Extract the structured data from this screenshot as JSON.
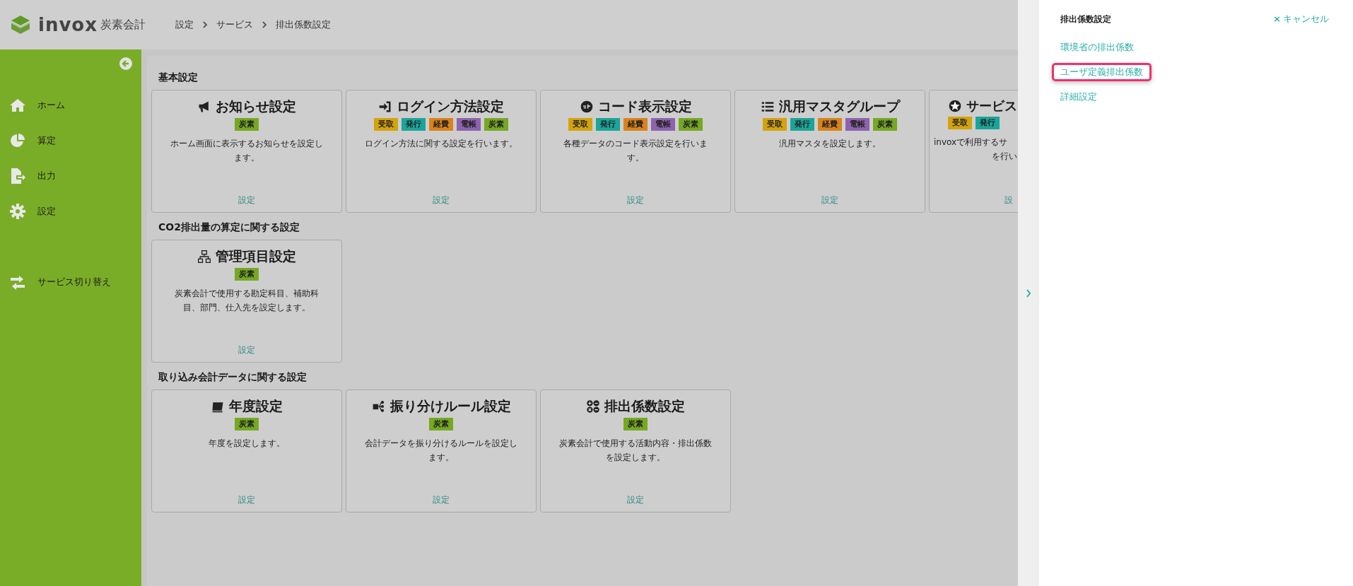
{
  "header": {
    "logo": {
      "name": "invox",
      "sub": "炭素会計"
    },
    "breadcrumb": [
      "設定",
      "サービス",
      "排出係数設定"
    ]
  },
  "sidebar": {
    "items": [
      {
        "label": "ホーム",
        "kind": "home"
      },
      {
        "label": "算定",
        "kind": "chart"
      },
      {
        "label": "出力",
        "kind": "export"
      },
      {
        "label": "設定",
        "kind": "gear"
      },
      {
        "label": "サービス切り替え",
        "kind": "switch"
      }
    ]
  },
  "sections": [
    {
      "title": "基本設定",
      "cards": [
        {
          "title": "お知らせ設定",
          "badges": [
            {
              "label": "炭素",
              "color": "#76a923"
            }
          ],
          "description_lines": [
            "ホーム画面に表示するお知らせを設定し",
            "ます。"
          ],
          "link": "設定"
        },
        {
          "title": "ログイン方法設定",
          "badges": [
            {
              "label": "受取",
              "color": "#d4a30a"
            },
            {
              "label": "発行",
              "color": "#1aa59a"
            },
            {
              "label": "経費",
              "color": "#d9831a"
            },
            {
              "label": "電帳",
              "color": "#8e63ad"
            },
            {
              "label": "炭素",
              "color": "#76a923"
            }
          ],
          "description_lines": [
            "ログイン方法に関する設定を行います。"
          ],
          "link": "設定"
        },
        {
          "title": "コード表示設定",
          "badges": [
            {
              "label": "受取",
              "color": "#d4a30a"
            },
            {
              "label": "発行",
              "color": "#1aa59a"
            },
            {
              "label": "経費",
              "color": "#d9831a"
            },
            {
              "label": "電帳",
              "color": "#8e63ad"
            },
            {
              "label": "炭素",
              "color": "#76a923"
            }
          ],
          "description_lines": [
            "各種データのコード表示設定を行いま",
            "す。"
          ],
          "link": "設定"
        },
        {
          "title": "汎用マスタグループ",
          "badges": [
            {
              "label": "受取",
              "color": "#d4a30a"
            },
            {
              "label": "発行",
              "color": "#1aa59a"
            },
            {
              "label": "経費",
              "color": "#d9831a"
            },
            {
              "label": "電帳",
              "color": "#8e63ad"
            },
            {
              "label": "炭素",
              "color": "#76a923"
            }
          ],
          "description_lines": [
            "汎用マスタを設定します。"
          ],
          "link": "設定"
        },
        {
          "title": "サービス",
          "badges": [
            {
              "label": "受取",
              "color": "#d4a30a"
            },
            {
              "label": "発行",
              "color": "#1aa59a"
            }
          ],
          "description_lines": [
            "invoxで利用するサ",
            "を行い"
          ],
          "link": "設"
        }
      ]
    },
    {
      "title": "CO2排出量の算定に関する設定",
      "cards": [
        {
          "title": "管理項目設定",
          "badges": [
            {
              "label": "炭素",
              "color": "#76a923"
            }
          ],
          "description_lines": [
            "炭素会計で使用する勘定科目、補助科",
            "目、部門、仕入先を設定します。"
          ],
          "link": "設定"
        }
      ]
    },
    {
      "title": "取り込み会計データに関する設定",
      "cards": [
        {
          "title": "年度設定",
          "badges": [
            {
              "label": "炭素",
              "color": "#76a923"
            }
          ],
          "description_lines": [
            "年度を設定します。"
          ],
          "link": "設定"
        },
        {
          "title": "振り分けルール設定",
          "badges": [
            {
              "label": "炭素",
              "color": "#76a923"
            }
          ],
          "description_lines": [
            "会計データを振り分けるルールを設定し",
            "ます。"
          ],
          "link": "設定"
        },
        {
          "title": "排出係数設定",
          "badges": [
            {
              "label": "炭素",
              "color": "#76a923"
            }
          ],
          "description_lines": [
            "炭素会計で使用する活動内容・排出係数",
            "を設定します。"
          ],
          "link": "設定"
        }
      ]
    }
  ],
  "panel": {
    "title": "排出係数設定",
    "cancel": {
      "icon": "×",
      "label": "キャンセル"
    },
    "links": [
      {
        "label": "環境省の排出係数",
        "highlighted": false
      },
      {
        "label": "ユーザ定義排出係数",
        "highlighted": true
      },
      {
        "label": "詳細設定",
        "highlighted": false
      }
    ]
  }
}
